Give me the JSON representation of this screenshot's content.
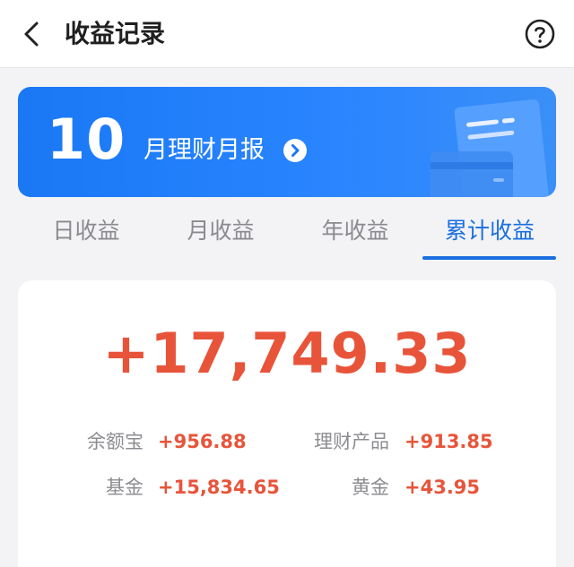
{
  "header": {
    "title": "收益记录"
  },
  "banner": {
    "month": "10",
    "text": "月理财月报"
  },
  "tabs": [
    {
      "label": "日收益",
      "active": false
    },
    {
      "label": "月收益",
      "active": false
    },
    {
      "label": "年收益",
      "active": false
    },
    {
      "label": "累计收益",
      "active": true
    }
  ],
  "summary": {
    "total": "+17,749.33",
    "items": [
      {
        "label": "余额宝",
        "value": "+956.88"
      },
      {
        "label": "理财产品",
        "value": "+913.85"
      },
      {
        "label": "基金",
        "value": "+15,834.65"
      },
      {
        "label": "黄金",
        "value": "+43.95"
      }
    ]
  },
  "colors": {
    "accent": "#1a6fe0",
    "banner": "#2a85ff",
    "gain": "#e8543a"
  }
}
